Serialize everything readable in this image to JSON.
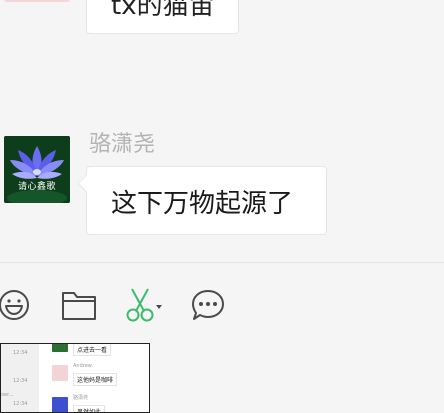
{
  "chat": {
    "previous_message_partial": "tx的猫宙",
    "message": {
      "sender": "骆潇尧",
      "text": "这下万物起源了",
      "avatar_caption": "请心鑫歌"
    }
  },
  "toolbar": {
    "icons": [
      "emoji-icon",
      "folder-icon",
      "scissors-icon",
      "chat-bubble-icon"
    ]
  },
  "thumbnail": {
    "times": [
      "12:34",
      "12:34",
      "12:34"
    ],
    "rows": [
      {
        "name": "",
        "text": "点进去一看"
      },
      {
        "name": "Andrew",
        "text": "这他妈是咖啡"
      },
      {
        "name": "骆潇尧",
        "text": "果然如此"
      }
    ],
    "left_snip": "oer..."
  },
  "colors": {
    "background": "#f5f5f5",
    "bubble": "#ffffff",
    "scissors_accent": "#3dbb6b",
    "sender_name": "#b3b3b3"
  }
}
